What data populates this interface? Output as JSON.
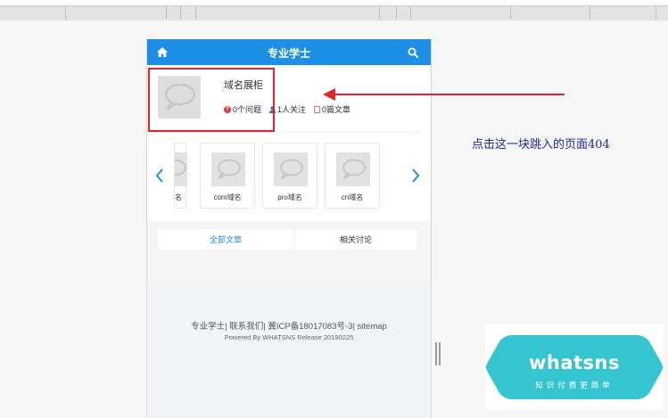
{
  "header": {
    "title": "专业学士"
  },
  "card": {
    "name": "域名展柜",
    "questions": "0个问题",
    "followers": "1人关注",
    "articles": "0篇文章"
  },
  "carousel": {
    "items": [
      {
        "label": "名"
      },
      {
        "label": "com域名"
      },
      {
        "label": "pro域名"
      },
      {
        "label": "cn域名"
      }
    ]
  },
  "tabs": {
    "all_articles": "全部文章",
    "discussion": "相关讨论"
  },
  "footer": {
    "links": "专业学士| 联系我们| 冀ICP备18017083号-3| sitemap",
    "powered": "Powered By WHATSNS Release 20190225"
  },
  "annotation": {
    "text": "点击这一块跳入的页面404"
  },
  "logo": {
    "word": "whatsns",
    "slogan": "知识付费更简单"
  },
  "colors": {
    "brand": "#1e8fe6",
    "highlight": "#e0262a",
    "annotation": "#1b2aa8",
    "logo": "#35c5d1"
  }
}
